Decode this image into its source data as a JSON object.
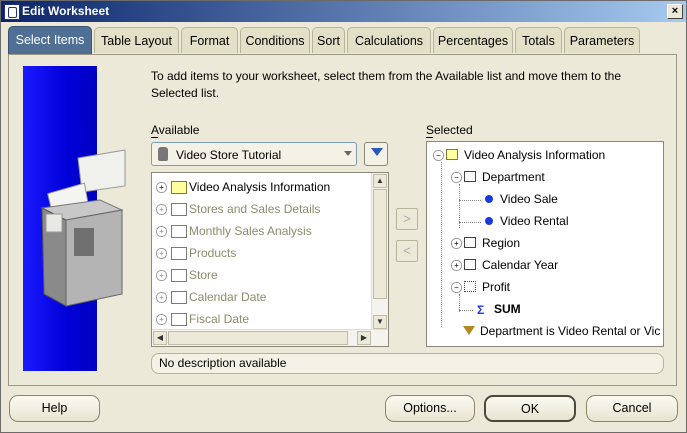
{
  "window": {
    "title": "Edit Worksheet",
    "close_glyph": "×"
  },
  "tabs": [
    "Select Items",
    "Table Layout",
    "Format",
    "Conditions",
    "Sort",
    "Calculations",
    "Percentages",
    "Totals",
    "Parameters"
  ],
  "instructions": "To add items to your worksheet, select them from the Available list and move them to the Selected list.",
  "available": {
    "label": "Available",
    "combo_value": "Video Store Tutorial",
    "items": [
      {
        "label": "Video Analysis Information",
        "dim": false
      },
      {
        "label": "Stores and Sales Details",
        "dim": true
      },
      {
        "label": "Monthly Sales Analysis",
        "dim": true
      },
      {
        "label": "Products",
        "dim": true
      },
      {
        "label": "Store",
        "dim": true
      },
      {
        "label": "Calendar Date",
        "dim": true
      },
      {
        "label": "Fiscal Date",
        "dim": true
      }
    ]
  },
  "move_buttons": {
    "right": ">",
    "left": "<"
  },
  "selected": {
    "label": "Selected",
    "root": "Video Analysis Information",
    "department": "Department",
    "video_sale": "Video Sale",
    "video_rental": "Video Rental",
    "region": "Region",
    "calendar_year": "Calendar Year",
    "profit": "Profit",
    "sum": "SUM",
    "condition": "Department is Video Rental or Vic"
  },
  "description": "No description available",
  "buttons": {
    "help": "Help",
    "options": "Options...",
    "ok": "OK",
    "cancel": "Cancel"
  },
  "colors": {
    "active_tab": "#4f6f95",
    "title_bar": "#0a246a",
    "blue_panel": "#0000d8"
  }
}
